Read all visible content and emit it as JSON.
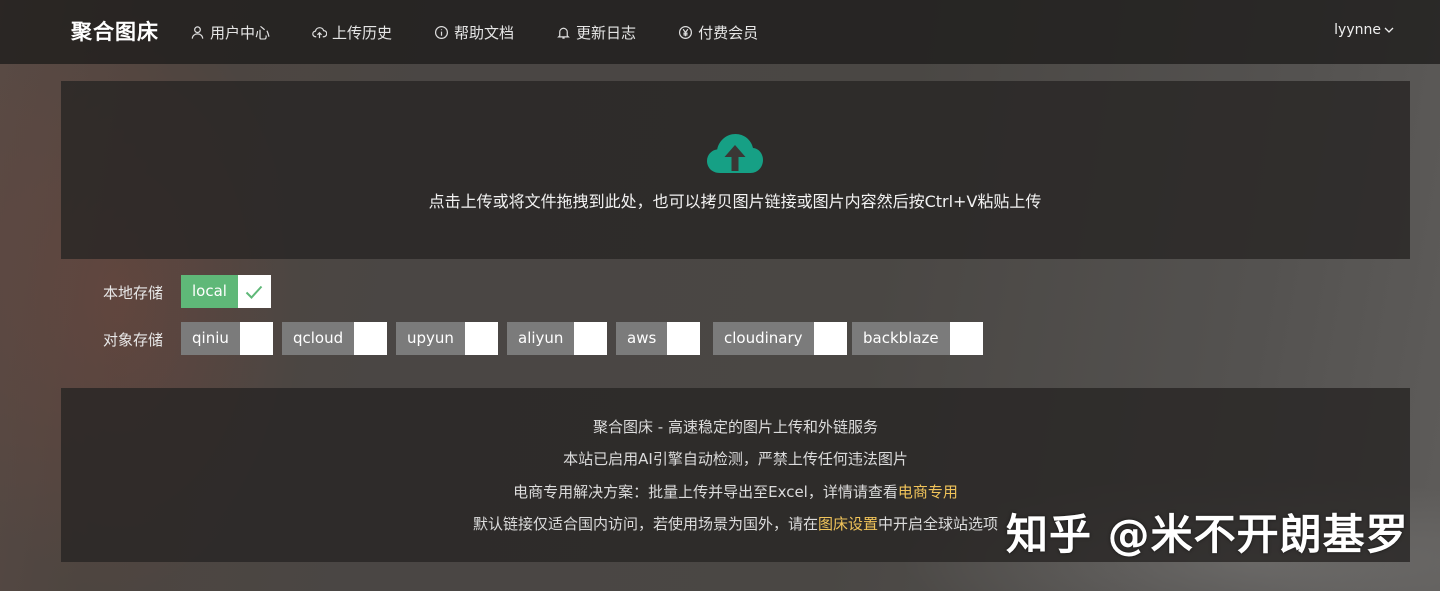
{
  "header": {
    "brand": "聚合图床",
    "nav": [
      {
        "label": "用户中心",
        "icon": "user-icon"
      },
      {
        "label": "上传历史",
        "icon": "cloud-upload-icon"
      },
      {
        "label": "帮助文档",
        "icon": "info-icon"
      },
      {
        "label": "更新日志",
        "icon": "bell-icon"
      },
      {
        "label": "付费会员",
        "icon": "yen-icon"
      }
    ],
    "user": "lyynne"
  },
  "upload": {
    "icon": "cloud-upload-icon",
    "hint": "点击上传或将文件拖拽到此处，也可以拷贝图片链接或图片内容然后按Ctrl+V粘贴上传"
  },
  "storage": {
    "local_label": "本地存储",
    "local_options": [
      {
        "name": "local",
        "checked": true
      }
    ],
    "object_label": "对象存储",
    "object_options": [
      {
        "name": "qiniu",
        "checked": false
      },
      {
        "name": "qcloud",
        "checked": false
      },
      {
        "name": "upyun",
        "checked": false
      },
      {
        "name": "aliyun",
        "checked": false
      },
      {
        "name": "aws",
        "checked": false
      },
      {
        "name": "cloudinary",
        "checked": false
      },
      {
        "name": "backblaze",
        "checked": false
      }
    ]
  },
  "info": {
    "line1": "聚合图床 - 高速稳定的图片上传和外链服务",
    "line2": "本站已启用AI引擎自动检测，严禁上传任何违法图片",
    "line3_prefix": "电商专用解决方案：批量上传并导出至Excel，详情请查看",
    "line3_link": "电商专用",
    "line4_prefix": "默认链接仅适合国内访问，若使用场景为国外，请在",
    "line4_link": "图床设置",
    "line4_suffix": "中开启全球站选项"
  },
  "watermark": "知乎 @米不开朗基罗",
  "colors": {
    "accent_green": "#5fb878",
    "icon_teal": "#16a085",
    "link_gold": "#f0c35a"
  }
}
